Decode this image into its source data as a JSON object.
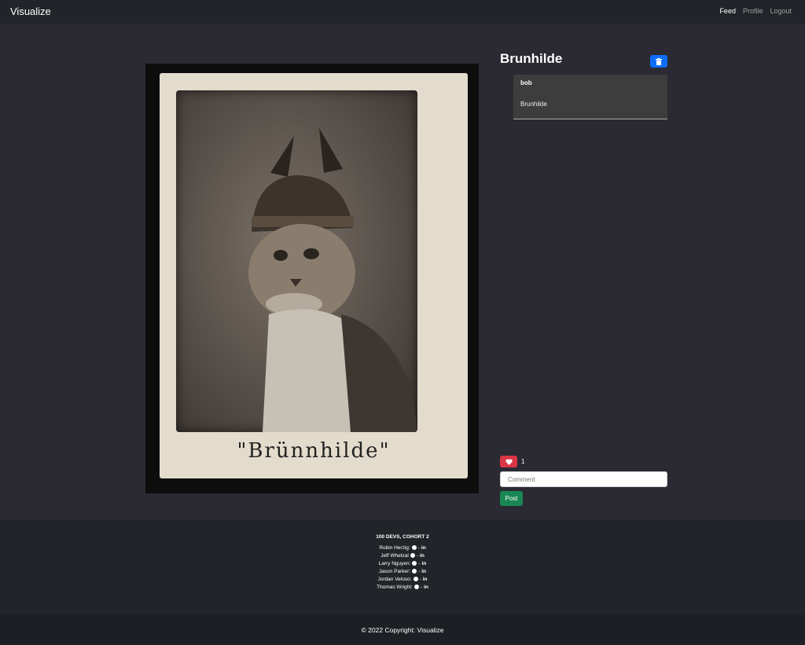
{
  "navbar": {
    "brand": "Visualize",
    "links": [
      "Feed",
      "Profile",
      "Logout"
    ],
    "active_link": "Feed"
  },
  "post": {
    "title": "Brunhilde",
    "image_caption_text": "\"Brünnhilde\"",
    "caption": {
      "user": "bob",
      "text": "Brunhilde"
    },
    "likes": "1",
    "comment_placeholder": "Comment",
    "post_button": "Post"
  },
  "footer": {
    "heading": "100 DEVS, COHORT 2",
    "contributors": [
      "Robin Herzig:",
      "Jeff Whetzal",
      "Larry Nguyen:",
      "Jason Parker:",
      "Jordan Veloso:",
      "Thomas Wright:"
    ],
    "separator": "-",
    "copyright": "© 2022 Copyright: Visualize"
  },
  "colors": {
    "background": "#2b2a33",
    "navbar": "#212529",
    "delete_button": "#0d6efd",
    "like_button": "#dc3545",
    "post_button": "#198754"
  },
  "icons": [
    "trash-icon",
    "heart-icon",
    "github-icon",
    "linkedin-icon"
  ]
}
